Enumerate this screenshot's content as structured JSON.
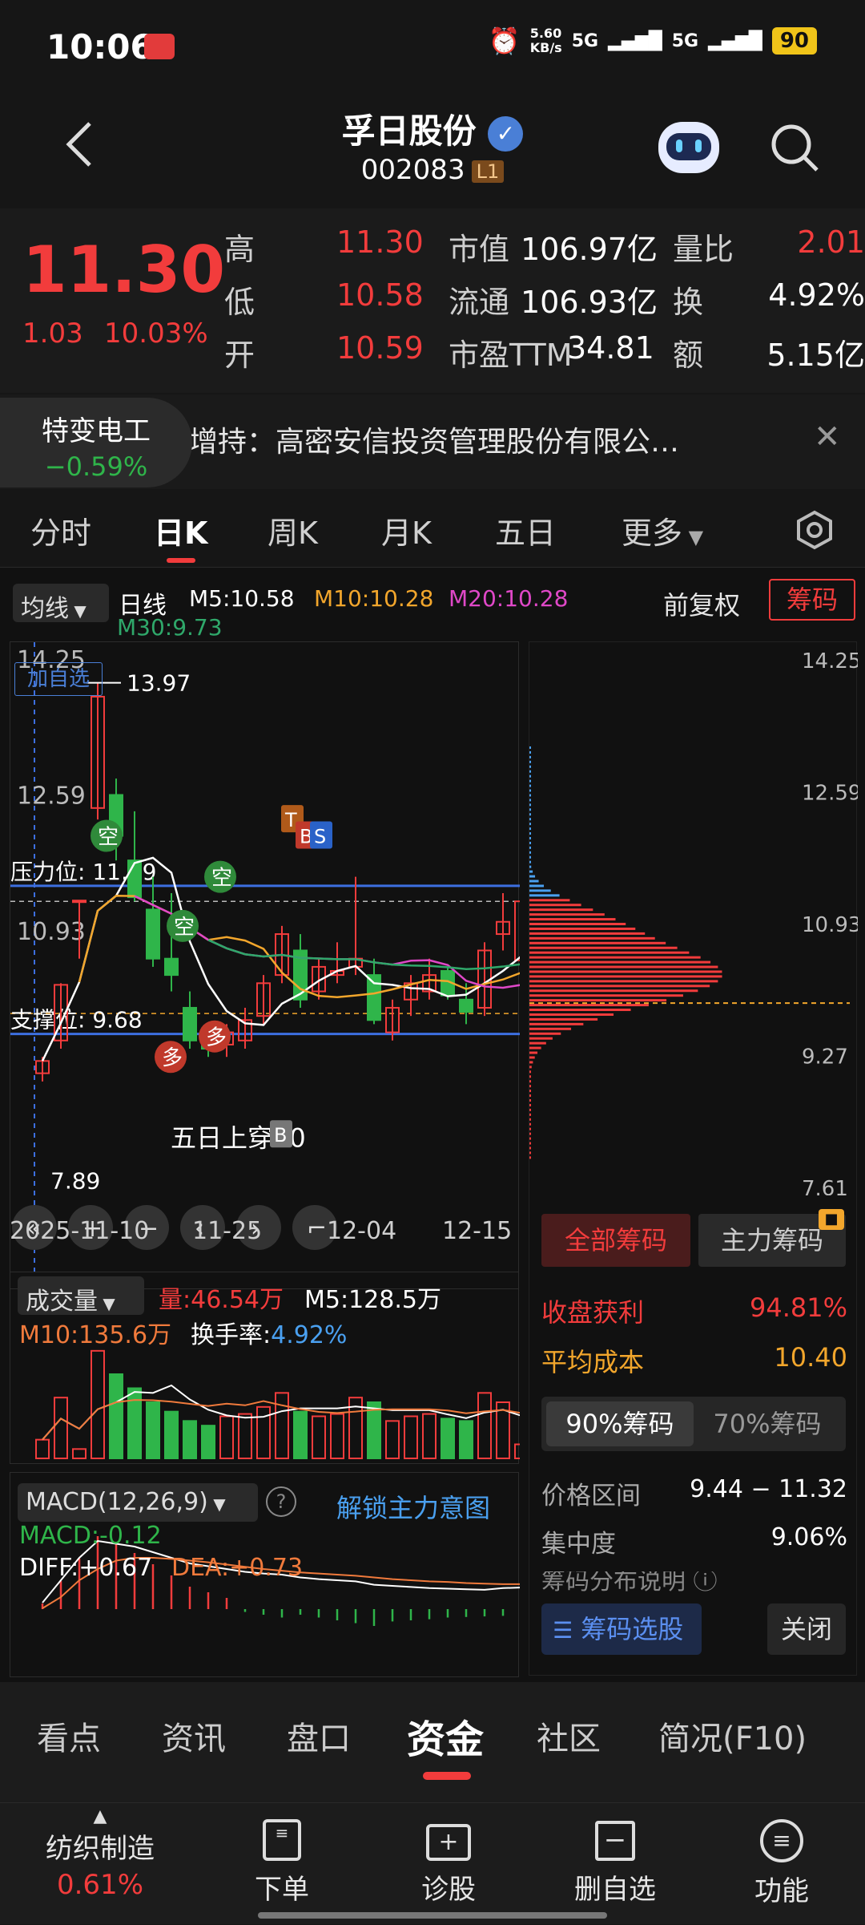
{
  "status": {
    "time": "10:06",
    "net_speed": "5.60\nKB/s",
    "net1": "5G",
    "net2": "5G",
    "battery": "90"
  },
  "header": {
    "title": "孚日股份",
    "code": "002083",
    "level": "L1"
  },
  "quote": {
    "price": "11.30",
    "change": "1.03",
    "change_pct": "10.03%",
    "rows": [
      {
        "k1": "高",
        "v1": "11.30",
        "k2": "市值",
        "v2": "106.97亿",
        "k3": "量比",
        "v3": "2.01"
      },
      {
        "k1": "低",
        "v1": "10.58",
        "k2": "流通",
        "v2": "106.93亿",
        "k3": "换",
        "v3": "4.92%"
      },
      {
        "k1": "开",
        "v1": "10.59",
        "k2": "市盈TTM",
        "v2": "34.81",
        "k3": "额",
        "v3": "5.15亿"
      }
    ]
  },
  "news": {
    "peer_name": "特变电工",
    "peer_change": "−0.59%",
    "text": "增持：高密安信投资管理股份有限公…"
  },
  "tabs": [
    "分时",
    "日K",
    "周K",
    "月K",
    "五日",
    "更多"
  ],
  "chart": {
    "ma_selector": "均线",
    "period": "日线",
    "ma_values": {
      "m5": "M5:10.58",
      "m10": "M10:10.28",
      "m20": "M20:10.28",
      "m30": "M30:9.73"
    },
    "adjust": "前复权",
    "chip_btn": "筹码",
    "add_watch": "加自选",
    "y_labels": [
      "14.25",
      "12.59",
      "10.93",
      "9.27",
      "7.61"
    ],
    "left_y": [
      "14.25",
      "12.59",
      "10.93"
    ],
    "annot_high": "13.97",
    "annot_low": "7.89",
    "pressure": "压力位: 11.49",
    "support": "支撑位: 9.68",
    "signal_text": "五日上穿10",
    "dates": [
      "2025-11-10",
      "11-25",
      "12-04",
      "12-15"
    ],
    "badges": {
      "kong": "空",
      "duo": "多",
      "t": "T",
      "b": "B",
      "s": "S"
    }
  },
  "chart_data": {
    "type": "candlestick",
    "x": [
      "11-10",
      "11-11",
      "11-12",
      "11-13",
      "11-14",
      "11-17",
      "11-18",
      "11-19",
      "11-20",
      "11-21",
      "11-24",
      "11-25",
      "11-26",
      "11-27",
      "11-28",
      "12-01",
      "12-02",
      "12-03",
      "12-04",
      "12-05",
      "12-08",
      "12-09",
      "12-10",
      "12-11",
      "12-12",
      "12-15",
      "12-16"
    ],
    "ohlc": [
      [
        9.2,
        9.4,
        9.1,
        9.35
      ],
      [
        9.6,
        10.3,
        9.5,
        10.28
      ],
      [
        11.31,
        11.31,
        10.6,
        11.31
      ],
      [
        12.44,
        13.97,
        12.3,
        13.8
      ],
      [
        12.6,
        12.8,
        11.8,
        12.1
      ],
      [
        11.8,
        12.4,
        11.3,
        11.35
      ],
      [
        11.2,
        11.6,
        10.5,
        10.6
      ],
      [
        10.6,
        11.4,
        10.2,
        10.4
      ],
      [
        10.0,
        10.2,
        9.5,
        9.6
      ],
      [
        9.6,
        9.8,
        9.4,
        9.5
      ],
      [
        9.55,
        9.8,
        9.4,
        9.7
      ],
      [
        9.6,
        10.0,
        9.5,
        9.85
      ],
      [
        9.9,
        10.4,
        9.8,
        10.3
      ],
      [
        10.4,
        11.0,
        10.3,
        10.9
      ],
      [
        10.7,
        10.9,
        10.0,
        10.1
      ],
      [
        10.2,
        10.6,
        10.1,
        10.5
      ],
      [
        10.4,
        10.8,
        10.3,
        10.45
      ],
      [
        10.5,
        11.6,
        10.4,
        10.6
      ],
      [
        10.4,
        10.6,
        9.8,
        9.85
      ],
      [
        9.7,
        10.1,
        9.6,
        10.0
      ],
      [
        10.1,
        10.4,
        9.9,
        10.3
      ],
      [
        10.2,
        10.6,
        10.1,
        10.4
      ],
      [
        10.45,
        10.5,
        10.1,
        10.15
      ],
      [
        10.1,
        10.3,
        9.8,
        9.95
      ],
      [
        10.0,
        10.8,
        9.9,
        10.7
      ],
      [
        10.9,
        11.4,
        10.7,
        11.05
      ],
      [
        10.58,
        11.3,
        10.58,
        11.3
      ]
    ],
    "ylim": [
      7.61,
      14.25
    ]
  },
  "chip": {
    "tabs": [
      "全部筹码",
      "主力筹码"
    ],
    "profit_label": "收盘获利",
    "profit": "94.81%",
    "avg_label": "平均成本",
    "avg": "10.40",
    "sub_tabs": [
      "90%筹码",
      "70%筹码"
    ],
    "range_label": "价格区间",
    "range": "9.44 − 11.32",
    "conc_label": "集中度",
    "conc": "9.06%",
    "note": "筹码分布说明",
    "select_btn": "筹码选股",
    "close_btn": "关闭"
  },
  "volume": {
    "selector": "成交量",
    "vol": "量:46.54万",
    "m5": "M5:128.5万",
    "m10": "M10:135.6万",
    "turnover_label": "换手率:",
    "turnover": "4.92%"
  },
  "macd": {
    "selector": "MACD(12,26,9)",
    "unlock": "解锁主力意图",
    "macd": "MACD:-0.12",
    "diff": "DIFF:+0.67",
    "dea": "DEA:+0.73"
  },
  "bottom_tabs": [
    "看点",
    "资讯",
    "盘口",
    "资金",
    "社区",
    "简况(F10)"
  ],
  "dock": {
    "sector": "纺织制造",
    "sector_change": "0.61%",
    "items": [
      "下单",
      "诊股",
      "删自选",
      "功能"
    ]
  }
}
